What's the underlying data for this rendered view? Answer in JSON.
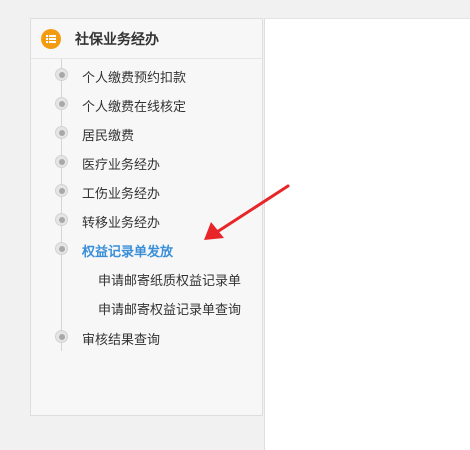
{
  "sidebar": {
    "title": "社保业务经办",
    "items": [
      {
        "label": "个人缴费预约扣款"
      },
      {
        "label": "个人缴费在线核定"
      },
      {
        "label": "居民缴费"
      },
      {
        "label": "医疗业务经办"
      },
      {
        "label": "工伤业务经办"
      },
      {
        "label": "转移业务经办"
      },
      {
        "label": "权益记录单发放"
      },
      {
        "label": "审核结果查询"
      }
    ],
    "sub_items": [
      {
        "label": "申请邮寄纸质权益记录单"
      },
      {
        "label": "申请邮寄权益记录单查询"
      }
    ],
    "active_item": "权益记录单发放"
  },
  "colors": {
    "accent": "#3b8fd9",
    "header_icon": "#f39c12",
    "arrow": "#e8262a"
  }
}
